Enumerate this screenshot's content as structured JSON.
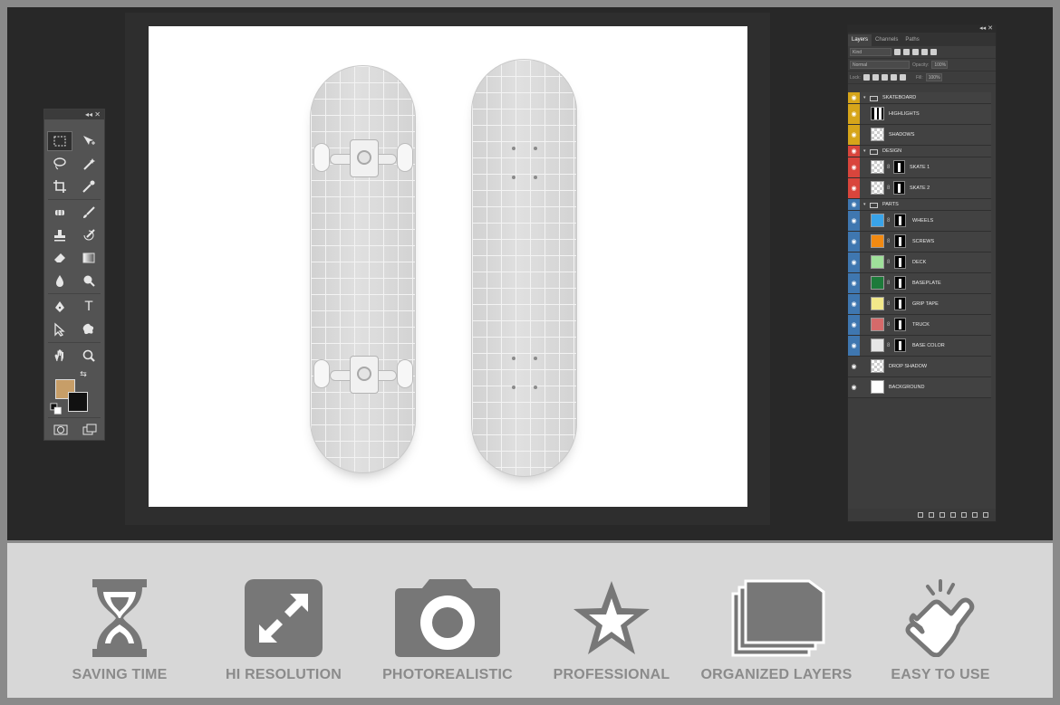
{
  "app": {
    "colors": {
      "workspace": "#282828",
      "panel": "#3d3d3d",
      "feature_bg": "#d7d7d7",
      "feature_gray": "#777777",
      "fg_swatch": "#c79e68",
      "bg_swatch": "#111111"
    }
  },
  "toolbox": {
    "header_icons": "◂◂ ✕",
    "tools": [
      "marquee-tool",
      "move-tool",
      "lasso-tool",
      "magic-wand-tool",
      "crop-tool",
      "eyedropper-tool",
      "healing-brush-tool",
      "brush-tool",
      "clone-stamp-tool",
      "history-brush-tool",
      "eraser-tool",
      "gradient-tool",
      "blur-tool",
      "dodge-tool",
      "pen-tool",
      "type-tool",
      "path-selection-tool",
      "shape-tool",
      "hand-tool",
      "zoom-tool"
    ],
    "type_glyph": "T"
  },
  "layers_panel": {
    "tabs": [
      "Layers",
      "Channels",
      "Paths"
    ],
    "filter": "Kind",
    "blend_mode": "Normal",
    "opacity_label": "Opacity:",
    "opacity_value": "100%",
    "lock_label": "Lock:",
    "fill_label": "Fill:",
    "fill_value": "100%",
    "layers": [
      {
        "name": "SKATEBOARD",
        "type": "group",
        "tag": "#d6a51a"
      },
      {
        "name": "HIGHLIGHTS",
        "type": "layer",
        "tag": "#d6a51a",
        "thumb": "mask-bars"
      },
      {
        "name": "SHADOWS",
        "type": "layer",
        "tag": "#d6a51a",
        "thumb": "checker"
      },
      {
        "name": "DESIGN",
        "type": "group",
        "tag": "#d9453c"
      },
      {
        "name": "SKATE 1",
        "type": "smart",
        "tag": "#d9453c"
      },
      {
        "name": "SKATE 2",
        "type": "smart",
        "tag": "#d9453c"
      },
      {
        "name": "PARTS",
        "type": "group",
        "tag": "#3f77b0"
      },
      {
        "name": "WHEELS",
        "type": "fill",
        "tag": "#3f77b0",
        "swatch": "#39a3e8"
      },
      {
        "name": "SCREWS",
        "type": "fill",
        "tag": "#3f77b0",
        "swatch": "#f28a12"
      },
      {
        "name": "DECK",
        "type": "fill",
        "tag": "#3f77b0",
        "swatch": "#9fe09a"
      },
      {
        "name": "BASEPLATE",
        "type": "fill",
        "tag": "#3f77b0",
        "swatch": "#1d7a3a"
      },
      {
        "name": "GRIP TAPE",
        "type": "fill",
        "tag": "#3f77b0",
        "swatch": "#f2e88a"
      },
      {
        "name": "TRUCK",
        "type": "fill",
        "tag": "#3f77b0",
        "swatch": "#d56a6a"
      },
      {
        "name": "BASE COLOR",
        "type": "fill",
        "tag": "#3f77b0",
        "swatch": "#e6e6e6"
      },
      {
        "name": "DROP SHADOW",
        "type": "layer",
        "tag": "",
        "thumb": "checker"
      },
      {
        "name": "BACKGROUND",
        "type": "layer",
        "tag": "",
        "thumb": "white"
      }
    ]
  },
  "features": [
    {
      "label": "SAVING TIME",
      "icon": "hourglass-icon"
    },
    {
      "label": "HI RESOLUTION",
      "icon": "expand-icon"
    },
    {
      "label": "PHOTOREALISTIC",
      "icon": "camera-icon"
    },
    {
      "label": "PROFESSIONAL",
      "icon": "star-icon"
    },
    {
      "label": "ORGANIZED LAYERS",
      "icon": "layers-icon"
    },
    {
      "label": "EASY TO USE",
      "icon": "tap-hand-icon"
    }
  ]
}
